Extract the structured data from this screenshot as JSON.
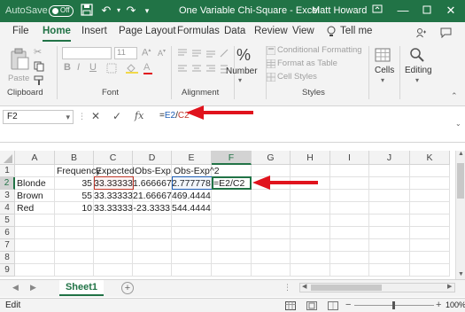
{
  "titlebar": {
    "autosave_label": "AutoSave",
    "autosave_state": "Off",
    "document_title": "One Variable Chi-Square  -  Excel",
    "user_name": "Matt Howard",
    "minimize_icon": "minimize-icon",
    "restore_icon": "restore-icon",
    "close_icon": "close-icon"
  },
  "tabs": {
    "file": "File",
    "home": "Home",
    "insert": "Insert",
    "page_layout": "Page Layout",
    "formulas": "Formulas",
    "data": "Data",
    "review": "Review",
    "view": "View",
    "tell_me": "Tell me"
  },
  "ribbon": {
    "paste": "Paste",
    "clipboard": "Clipboard",
    "font_size": "11",
    "font_group": "Font",
    "bold": "B",
    "italic": "I",
    "underline": "U",
    "alignment": "Alignment",
    "number_btn": "Number",
    "percent": "%",
    "conditional_formatting": "Conditional Formatting",
    "format_as_table": "Format as Table",
    "cell_styles": "Cell Styles",
    "styles": "Styles",
    "cells": "Cells",
    "editing": "Editing"
  },
  "formula_bar": {
    "name_box": "F2",
    "cancel_symbol": "✕",
    "enter_symbol": "✓",
    "fx_label": "fx",
    "formula_prefix": "=",
    "ref1": "E2",
    "operator": "/",
    "ref2": "C2"
  },
  "grid": {
    "columns": [
      "A",
      "B",
      "C",
      "D",
      "E",
      "F",
      "G",
      "H",
      "I",
      "J",
      "K"
    ],
    "rows": [
      "1",
      "2",
      "3",
      "4",
      "5",
      "6",
      "7",
      "8",
      "9"
    ],
    "headers": [
      "",
      "Frequency",
      "Expected",
      "Obs-Exp",
      "Obs-Exp^2"
    ],
    "data": [
      [
        "Blonde",
        "35",
        "33.33333",
        "1.666667",
        "2.777778",
        "=E2/C2"
      ],
      [
        "Brown",
        "55",
        "33.33333",
        "21.66667",
        "469.4444",
        ""
      ],
      [
        "Red",
        "10",
        "33.33333",
        "-23.3333",
        "544.4444",
        ""
      ]
    ]
  },
  "sheets": {
    "active": "Sheet1",
    "add_label": "+"
  },
  "status": {
    "mode": "Edit",
    "zoom": "100%",
    "zoom_minus": "−",
    "zoom_plus": "+"
  },
  "colors": {
    "excel_green": "#217346",
    "ref_blue": "#1f5fb5",
    "ref_red": "#c0392b",
    "annotation_red": "#e0131d"
  }
}
